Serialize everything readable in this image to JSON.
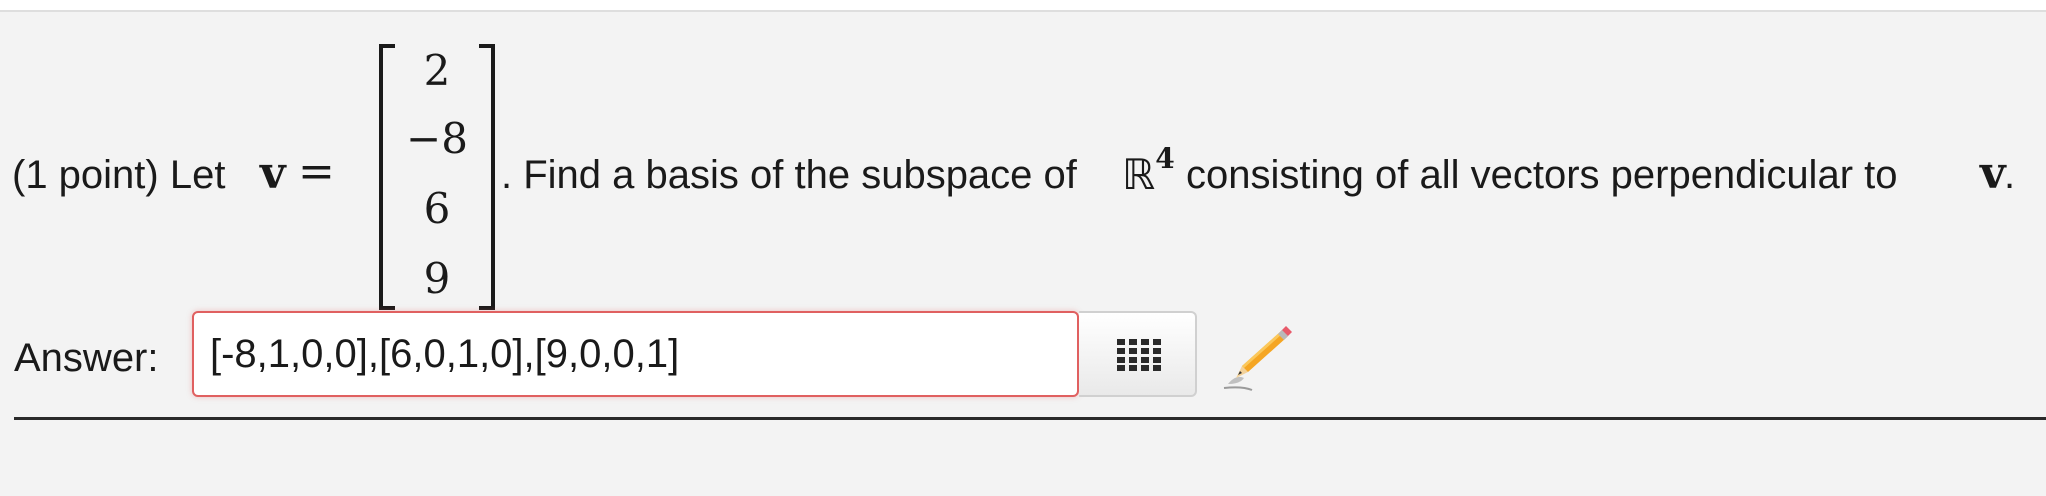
{
  "problem": {
    "prefix": "(1 point) Let ",
    "vector_symbol": "v",
    "equals": " = ",
    "vector_entries": [
      "2",
      "−8",
      "6",
      "9"
    ],
    "middle_text": ". Find a basis of the subspace of ",
    "space_symbol": "ℝ",
    "space_exponent": "4",
    "suffix_text": " consisting of all vectors perpendicular to ",
    "end_symbol": "v",
    "end_period": "."
  },
  "answer": {
    "label": "Answer:",
    "value": "[-8,1,0,0],[6,0,1,0],[9,0,0,1]"
  },
  "icons": {
    "matrix_button": "grid-icon",
    "feedback": "pencil-icon"
  },
  "colors": {
    "input_border": "#e06060",
    "pencil": "#f5a623"
  }
}
